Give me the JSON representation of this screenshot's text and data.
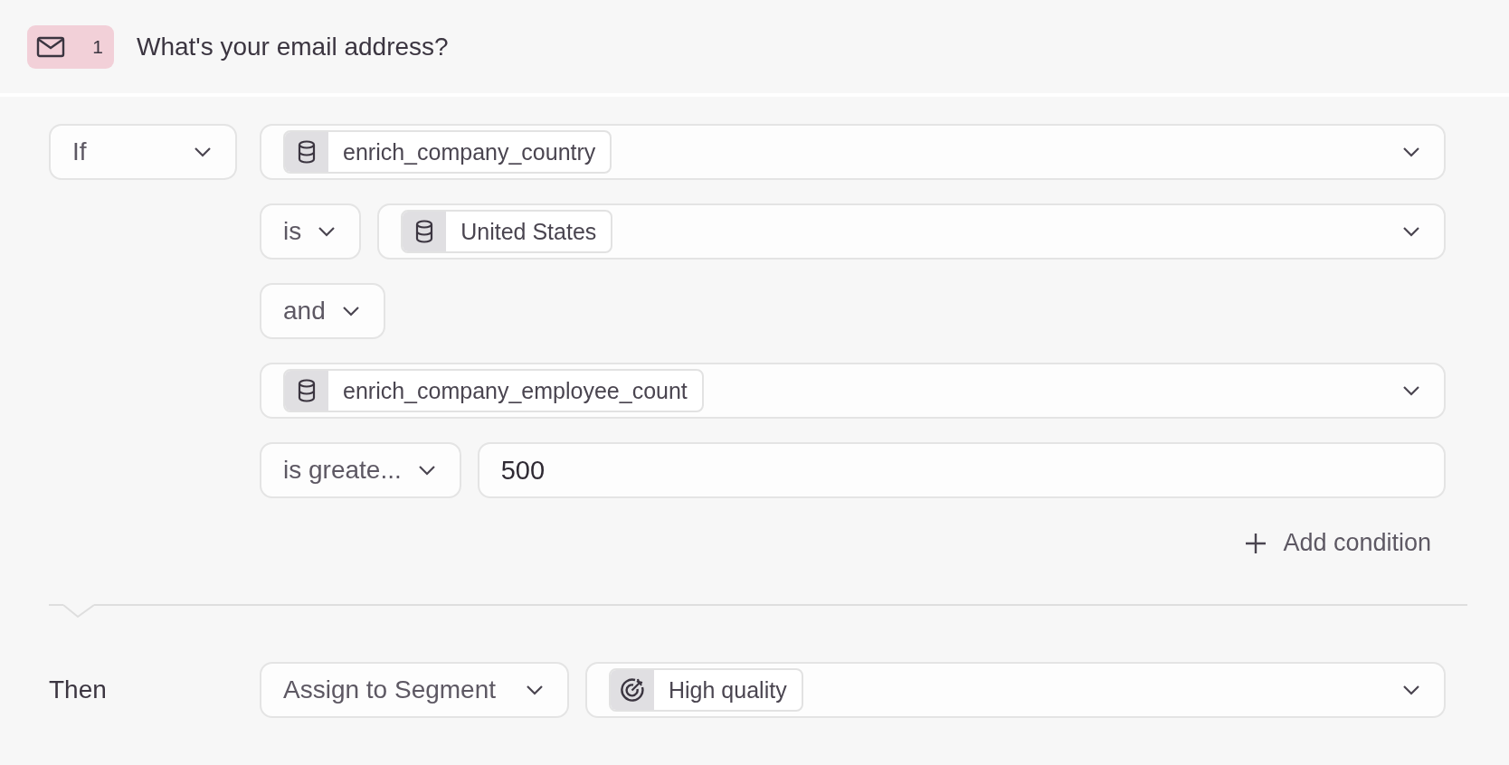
{
  "header": {
    "badge": "1",
    "title": "What's your email address?"
  },
  "condition": {
    "prefix": "If",
    "rows": [
      {
        "kind": "field",
        "chip": "enrich_company_country"
      },
      {
        "kind": "compare",
        "operator": "is",
        "chip": "United States"
      },
      {
        "kind": "joiner",
        "label": "and"
      },
      {
        "kind": "field",
        "chip": "enrich_company_employee_count"
      },
      {
        "kind": "compare_input",
        "operator": "is greate...",
        "value": "500"
      }
    ],
    "add_button": "Add condition"
  },
  "action": {
    "label": "Then",
    "type": "Assign to Segment",
    "chip": "High quality"
  }
}
